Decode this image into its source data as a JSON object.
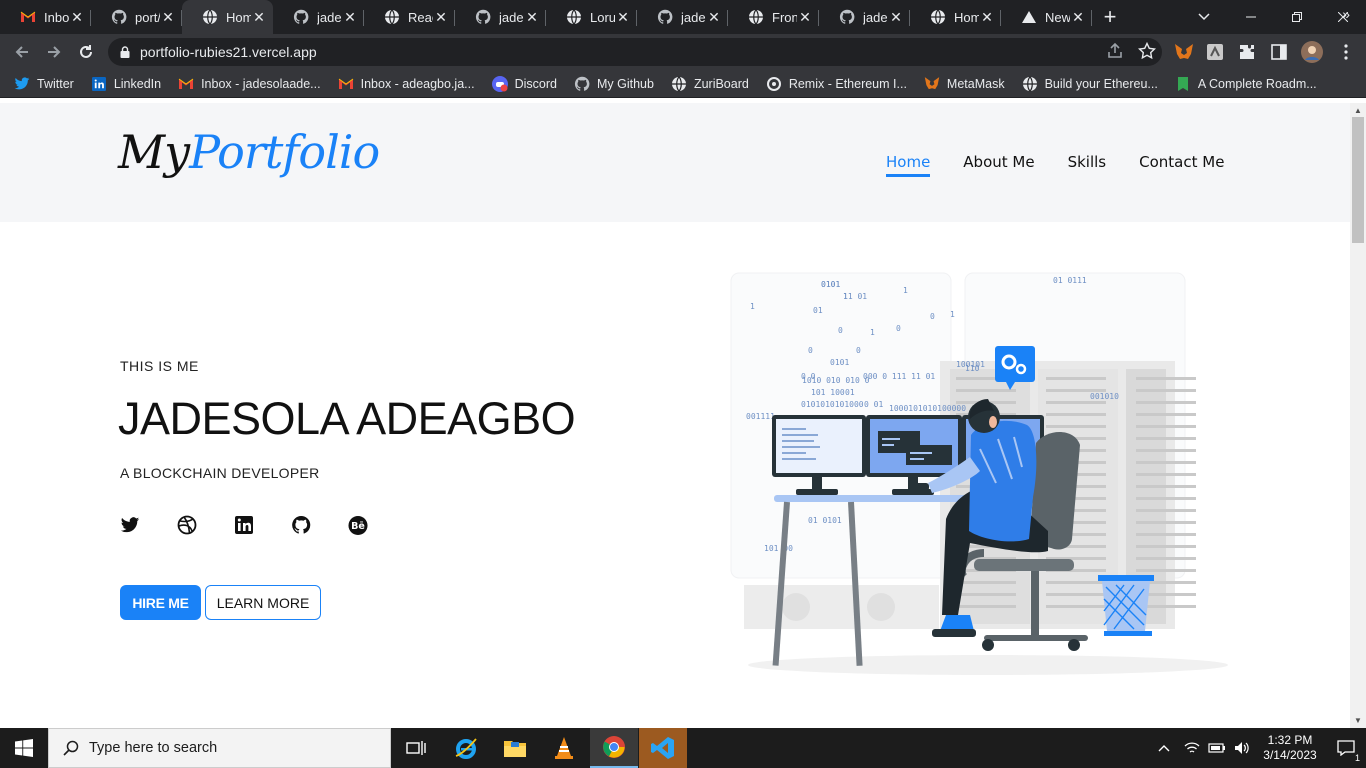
{
  "browser": {
    "tabs": [
      {
        "label": "Inbox",
        "icon": "gmail-icon",
        "active": false
      },
      {
        "label": "port/",
        "icon": "github-icon",
        "active": false
      },
      {
        "label": "Hom",
        "icon": "globe-icon",
        "active": true
      },
      {
        "label": "jades",
        "icon": "github-icon",
        "active": false
      },
      {
        "label": "Reac",
        "icon": "globe-icon",
        "active": false
      },
      {
        "label": "jades",
        "icon": "github-icon",
        "active": false
      },
      {
        "label": "Loruk",
        "icon": "globe-icon",
        "active": false
      },
      {
        "label": "jades",
        "icon": "github-icon",
        "active": false
      },
      {
        "label": "Front",
        "icon": "globe-icon",
        "active": false
      },
      {
        "label": "jades",
        "icon": "github-icon",
        "active": false
      },
      {
        "label": "Hom",
        "icon": "globe-icon",
        "active": false
      },
      {
        "label": "New",
        "icon": "vercel-icon",
        "active": false
      }
    ],
    "url": "portfolio-rubies21.vercel.app",
    "bookmarks": [
      {
        "label": "Twitter",
        "icon": "twitter-icon"
      },
      {
        "label": "LinkedIn",
        "icon": "linkedin-icon"
      },
      {
        "label": "Inbox - jadesolaade...",
        "icon": "gmail-icon"
      },
      {
        "label": "Inbox - adeagbo.ja...",
        "icon": "gmail-icon"
      },
      {
        "label": "Discord",
        "icon": "discord-icon"
      },
      {
        "label": "My Github",
        "icon": "github-icon"
      },
      {
        "label": "ZuriBoard",
        "icon": "globe-icon"
      },
      {
        "label": "Remix - Ethereum I...",
        "icon": "remix-icon"
      },
      {
        "label": "MetaMask",
        "icon": "metamask-icon"
      },
      {
        "label": "Build your Ethereu...",
        "icon": "globe-icon"
      },
      {
        "label": "A Complete Roadm...",
        "icon": "bookmark-doc-icon"
      }
    ],
    "bookmarks_overflow": "»"
  },
  "site": {
    "logo_part1": "My",
    "logo_part2": "Portfolio",
    "nav": [
      {
        "label": "Home",
        "active": true
      },
      {
        "label": "About Me",
        "active": false
      },
      {
        "label": "Skills",
        "active": false
      },
      {
        "label": "Contact Me",
        "active": false
      }
    ],
    "intro": {
      "kicker": "THIS IS ME",
      "name": "JADESOLA ADEAGBO",
      "role": "A BLOCKCHAIN DEVELOPER"
    },
    "socials": [
      "twitter-icon",
      "dribbble-icon",
      "linkedin-icon",
      "github-icon",
      "behance-icon"
    ],
    "hire_label": "HIRE ME",
    "learn_label": "LEARN MORE",
    "accent": "#1a82f7",
    "art_binary": [
      "0101",
      "1",
      "1",
      "01",
      "1",
      "0",
      "0",
      "1",
      "0",
      "0",
      "0",
      "1",
      "0101",
      "0 0",
      "1010 010 010 0",
      "000 0 111 11 01",
      "101 100",
      "01",
      "0101010101000",
      "0 01",
      "1000101010100000",
      "001111",
      "100101",
      "110",
      "001010",
      "0101",
      "01 0111",
      "01 0101",
      "101 00",
      "0101",
      "11 01"
    ]
  },
  "taskbar": {
    "search_placeholder": "Type here to search",
    "time": "1:32 PM",
    "date": "3/14/2023",
    "notification_count": "1"
  }
}
